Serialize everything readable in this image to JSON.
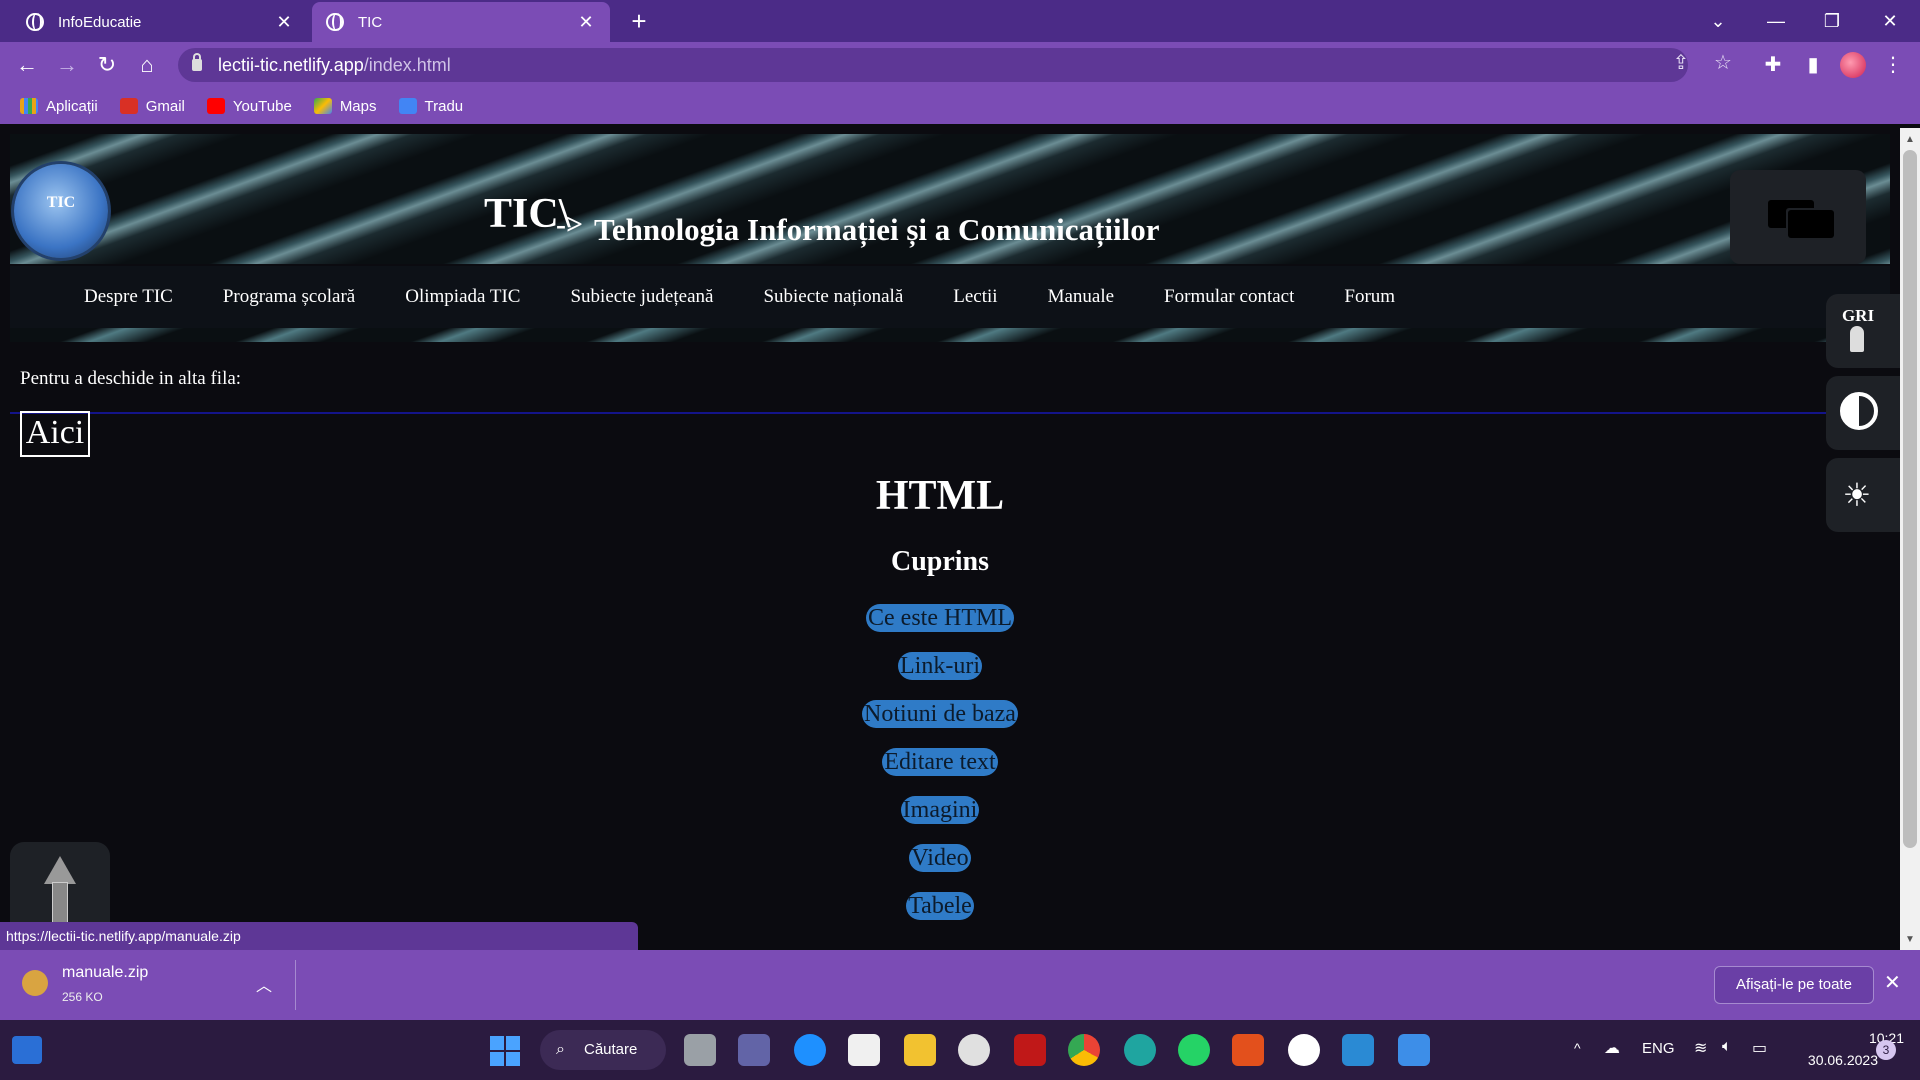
{
  "browser": {
    "tabs": [
      {
        "title": "InfoEducatie",
        "close": "✕"
      },
      {
        "title": "TIC",
        "close": "✕"
      }
    ],
    "new_tab": "+",
    "window_controls": {
      "tabsearch": "⌄",
      "minimize": "—",
      "restore": "❐",
      "close": "✕"
    },
    "url_host": "lectii-tic.netlify.app",
    "url_path": "/index.html",
    "nav": {
      "back": "←",
      "forward": "→",
      "reload": "↻",
      "home": "⌂"
    },
    "toolbar_icons": {
      "share": "⇪",
      "star": "☆",
      "extensions": "✚",
      "sidepanel": "▮",
      "menu": "⋮"
    },
    "bookmarks": [
      {
        "label": "Aplicații",
        "color": "#e8a317"
      },
      {
        "label": "Gmail",
        "color": "#d93025"
      },
      {
        "label": "YouTube",
        "color": "#ff0000"
      },
      {
        "label": "Maps",
        "color": "#34a853"
      },
      {
        "label": "Tradu",
        "color": "#4285f4"
      }
    ]
  },
  "page": {
    "logo_text": "TIC",
    "title_prefix": "TIC\\",
    "title_arrow": "->",
    "title_main": "Tehnologia Informației și a Comunicațiilor",
    "nav_items": [
      "Despre TIC",
      "Programa școlară",
      "Olimpiada TIC",
      "Subiecte județeană",
      "Subiecte națională",
      "Lectii",
      "Manuale",
      "Formular contact",
      "Forum"
    ],
    "intro_text": "Pentru a deschide in alta fila:",
    "aici_link": "Aici",
    "heading": "HTML",
    "subheading": "Cuprins",
    "toc": [
      "Ce este HTML",
      "Link-uri",
      "Notiuni de baza",
      "Editare text",
      "Imagini",
      "Video",
      "Tabele"
    ],
    "a11y_gray_label": "GRI",
    "a11y_bright_icon": "☀"
  },
  "status_url": "https://lectii-tic.netlify.app/manuale.zip",
  "download": {
    "file_name": "manuale.zip",
    "file_size": "256 KO",
    "menu_icon": "︿",
    "show_all": "Afișați-le pe toate",
    "close": "✕"
  },
  "taskbar": {
    "search_label": "Căutare",
    "search_icon": "🔍",
    "lang": "ENG",
    "time": "10:21",
    "date": "30.06.2023",
    "notifications": "3",
    "chevron": "^",
    "apps": [
      {
        "name": "task-view",
        "color": "#9aa0a6"
      },
      {
        "name": "teams-chat",
        "color": "#6264a7"
      },
      {
        "name": "get-help",
        "color": "#1e90ff"
      },
      {
        "name": "microsoft-store",
        "color": "#f0f0f0"
      },
      {
        "name": "file-explorer",
        "color": "#f2c230"
      },
      {
        "name": "github-desktop",
        "color": "#e0e0e0"
      },
      {
        "name": "mcafee",
        "color": "#c01818"
      },
      {
        "name": "chrome",
        "color": "#34a853"
      },
      {
        "name": "edge",
        "color": "#1fa5a0"
      },
      {
        "name": "whatsapp",
        "color": "#25d366"
      },
      {
        "name": "office",
        "color": "#e3501c"
      },
      {
        "name": "github",
        "color": "#ffffff"
      },
      {
        "name": "vscode",
        "color": "#2a8ad4"
      },
      {
        "name": "photos",
        "color": "#3d8ee8"
      }
    ]
  }
}
